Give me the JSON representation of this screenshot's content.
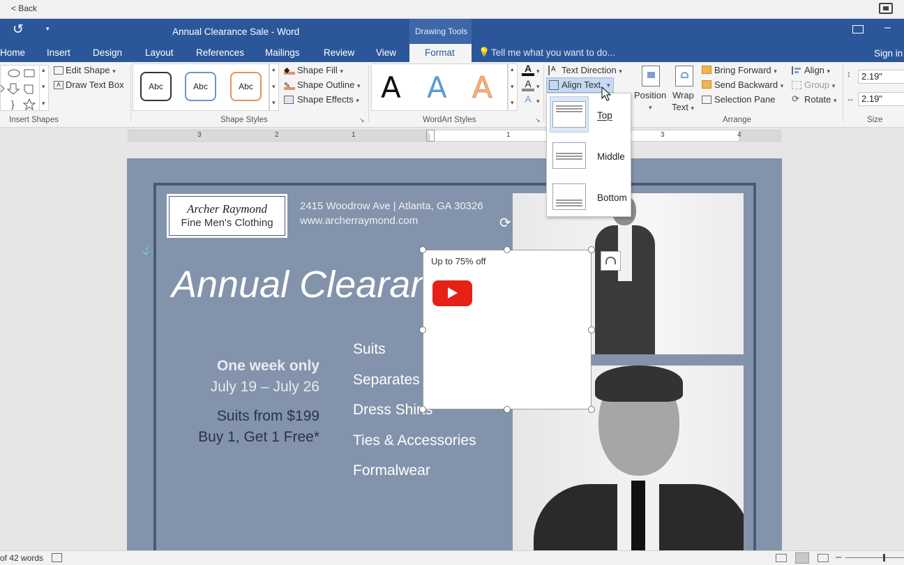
{
  "topbar": {
    "back": "< Back"
  },
  "titlebar": {
    "title": "Annual Clearance Sale - Word",
    "context_tab": "Drawing Tools",
    "tell_me": "Tell me what you want to do...",
    "sign_in": "Sign in"
  },
  "tabs": [
    "Home",
    "Insert",
    "Design",
    "Layout",
    "References",
    "Mailings",
    "Review",
    "View",
    "Format"
  ],
  "ribbon": {
    "insert_shapes": {
      "edit_shape": "Edit Shape",
      "draw_text_box": "Draw Text Box",
      "label": "Insert Shapes"
    },
    "shape_styles": {
      "preset": "Abc",
      "fill": "Shape Fill",
      "outline": "Shape Outline",
      "effects": "Shape Effects",
      "label": "Shape Styles"
    },
    "wordart": {
      "letter": "A",
      "label": "WordArt Styles"
    },
    "text": {
      "direction": "Text Direction",
      "align": "Align Text"
    },
    "arrange": {
      "position": "Position",
      "wrap": "Wrap",
      "wrap2": "Text",
      "bring_forward": "Bring Forward",
      "send_backward": "Send Backward",
      "selection_pane": "Selection Pane",
      "align": "Align",
      "group": "Group",
      "rotate": "Rotate",
      "label": "Arrange"
    },
    "size": {
      "height": "2.19\"",
      "width": "2.19\"",
      "label": "Size"
    }
  },
  "ruler": {
    "nums": [
      "3",
      "2",
      "1",
      "1",
      "2",
      "3",
      "4"
    ]
  },
  "align_menu": {
    "items": [
      "Top",
      "Middle",
      "Bottom"
    ]
  },
  "doc": {
    "logo1": "Archer Raymond",
    "logo2": "Fine Men's Clothing",
    "address": "2415 Woodrow Ave | Atlanta, GA 30326",
    "web": "www.archerraymond.com",
    "headline": "Annual Clearance",
    "week": "One week only",
    "dates": "July 19 – July 26",
    "suits_from": "Suits from $199",
    "bogo": "Buy 1, Get 1 Free*",
    "list": [
      "Suits",
      "Separates",
      "Dress Shirts",
      "Ties & Accessories",
      "Formalwear"
    ],
    "textbox": "Up to 75% off"
  },
  "status": {
    "words": "of 42 words"
  },
  "colors": {
    "accent": "#2b579a",
    "page_bg": "#8393ab",
    "youtube": "#e62117"
  }
}
